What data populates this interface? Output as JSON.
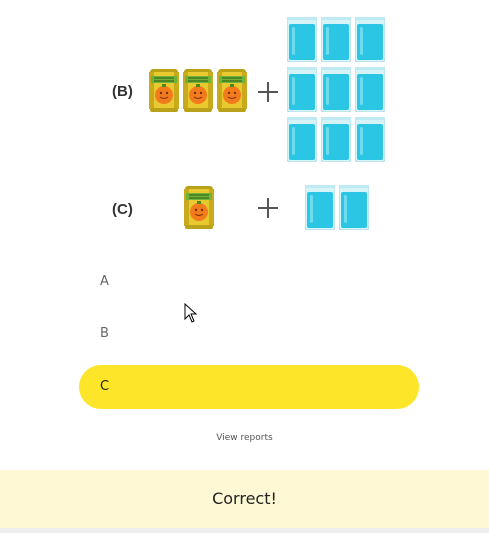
{
  "rows": [
    {
      "label": "(B)",
      "cans": 3,
      "glasses": 9
    },
    {
      "label": "(C)",
      "cans": 1,
      "glasses": 2
    }
  ],
  "can_text": "ORANGE JUICE CONCENTRATE",
  "options": [
    {
      "letter": "A",
      "selected": false
    },
    {
      "letter": "B",
      "selected": false
    },
    {
      "letter": "C",
      "selected": true
    }
  ],
  "view_reports": "View reports",
  "feedback": "Correct!",
  "colors": {
    "selected": "#fde52a",
    "feedback_bg": "#fef8d4",
    "water": "#2bc6e3"
  }
}
